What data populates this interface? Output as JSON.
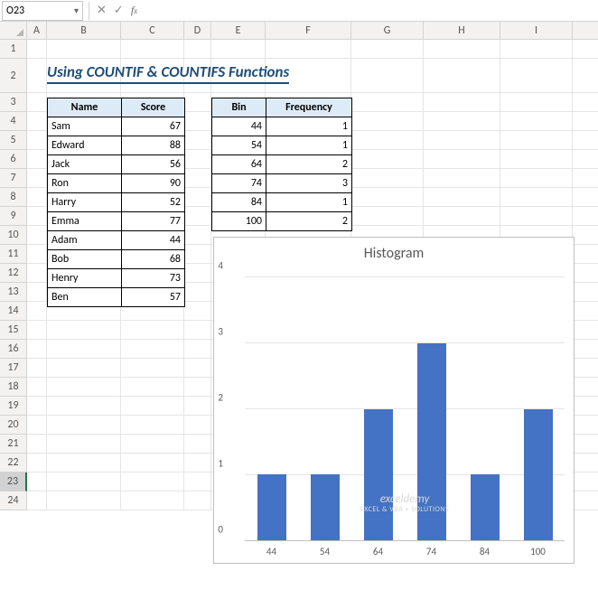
{
  "name_box": "O23",
  "formula": "",
  "columns": [
    "A",
    "B",
    "C",
    "D",
    "E",
    "F",
    "G",
    "H",
    "I"
  ],
  "rows": [
    "1",
    "2",
    "3",
    "4",
    "5",
    "6",
    "7",
    "8",
    "9",
    "10",
    "11",
    "12",
    "13",
    "14",
    "15",
    "16",
    "17",
    "18",
    "19",
    "20",
    "21",
    "22",
    "23",
    "24"
  ],
  "title": "Using COUNTIF & COUNTIFS Functions",
  "table1": {
    "headers": [
      "Name",
      "Score"
    ],
    "rows": [
      [
        "Sam",
        "67"
      ],
      [
        "Edward",
        "88"
      ],
      [
        "Jack",
        "56"
      ],
      [
        "Ron",
        "90"
      ],
      [
        "Harry",
        "52"
      ],
      [
        "Emma",
        "77"
      ],
      [
        "Adam",
        "44"
      ],
      [
        "Bob",
        "68"
      ],
      [
        "Henry",
        "73"
      ],
      [
        "Ben",
        "57"
      ]
    ]
  },
  "table2": {
    "headers": [
      "Bin",
      "Frequency"
    ],
    "rows": [
      [
        "44",
        "1"
      ],
      [
        "54",
        "1"
      ],
      [
        "64",
        "2"
      ],
      [
        "74",
        "3"
      ],
      [
        "84",
        "1"
      ],
      [
        "100",
        "2"
      ]
    ]
  },
  "chart_data": {
    "type": "bar",
    "title": "Histogram",
    "categories": [
      "44",
      "54",
      "64",
      "74",
      "84",
      "100"
    ],
    "values": [
      1,
      1,
      2,
      3,
      1,
      2
    ],
    "ylim": [
      0,
      4
    ],
    "yticks": [
      0,
      1,
      2,
      3,
      4
    ],
    "xlabel": "",
    "ylabel": ""
  },
  "watermark": {
    "main": "exceldemy",
    "sub": "EXCEL & VBA + SOLUTIONS"
  }
}
